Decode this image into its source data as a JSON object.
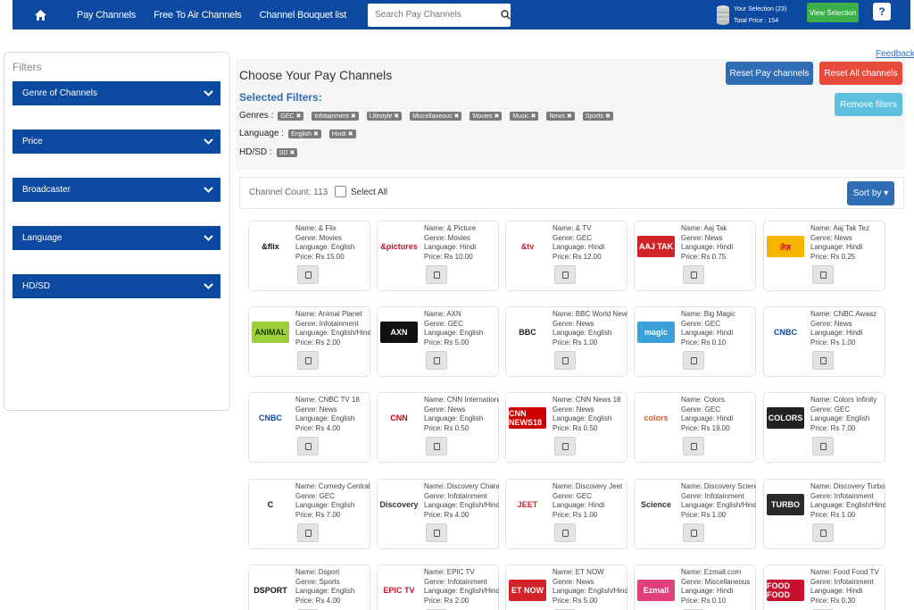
{
  "nav": {
    "links": [
      "Pay Channels",
      "Free To Air Channels",
      "Channel Bouquet list"
    ],
    "search_placeholder": "Search Pay Channels",
    "selection_label": "Your Selection (23)",
    "total_price": "Total Price : 154",
    "view_selection": "View Selection",
    "help": "?"
  },
  "sidebar": {
    "title": "Filters",
    "items": [
      "Genre of Channels",
      "Price",
      "Broadcaster",
      "Language",
      "HD/SD"
    ]
  },
  "main": {
    "feedback": "Feedback",
    "title": "Choose Your Pay Channels",
    "reset_pay": "Reset Pay channels",
    "reset_all": "Reset All channels",
    "remove_filters": "Remove filters",
    "selected_filters_title": "Selected Filters:",
    "filter_rows": [
      {
        "label": "Genres :",
        "tags": [
          "GEC ✖",
          "Infotainment ✖",
          "Lifestyle ✖",
          "Miscellaneous ✖",
          "Movies ✖",
          "Music ✖",
          "News ✖",
          "Sports ✖"
        ]
      },
      {
        "label": "Language :",
        "tags": [
          "English ✖",
          "Hindi ✖"
        ]
      },
      {
        "label": "HD/SD :",
        "tags": [
          "SD ✖"
        ]
      }
    ],
    "channel_count": "Channel Count: 113",
    "select_all": "Select All",
    "sort_by": "Sort by ▾"
  },
  "channels": [
    {
      "name": "Name: & Flix",
      "genre": "Genre: Movies",
      "language": "Language: English",
      "price": "Price: Rs 15.00",
      "logo": "&flix",
      "logo_color": "#111111",
      "logo_bg": "#ffffff"
    },
    {
      "name": "Name: & Picture",
      "genre": "Genre: Movies",
      "language": "Language: Hindi",
      "price": "Price: Rs 10.00",
      "logo": "&pictures",
      "logo_color": "#c8102e",
      "logo_bg": "#ffffff"
    },
    {
      "name": "Name: & TV",
      "genre": "Genre: GEC",
      "language": "Language: Hindi",
      "price": "Price: Rs 12.00",
      "logo": "&tv",
      "logo_color": "#d6202e",
      "logo_bg": "#ffffff"
    },
    {
      "name": "Name: Aaj Tak",
      "genre": "Genre: News",
      "language": "Language: Hindi",
      "price": "Price: Rs 0.75",
      "logo": "AAJ TAK",
      "logo_color": "#ffffff",
      "logo_bg": "#d2232a"
    },
    {
      "name": "Name: Aaj Tak Tez",
      "genre": "Genre: News",
      "language": "Language: Hindi",
      "price": "Price: Rs 0.25",
      "logo": "तेज़",
      "logo_color": "#c8102e",
      "logo_bg": "#f7b500"
    },
    {
      "name": "Name: Animal Planet",
      "genre": "Genre: Infotainment",
      "language": "Language: English/Hindi",
      "price": "Price: Rs 2.00",
      "logo": "ANIMAL",
      "logo_color": "#1e3d0e",
      "logo_bg": "#9ccf3a"
    },
    {
      "name": "Name: AXN",
      "genre": "Genre: GEC",
      "language": "Language: English",
      "price": "Price: Rs 5.00",
      "logo": "AXN",
      "logo_color": "#ffffff",
      "logo_bg": "#111111"
    },
    {
      "name": "Name: BBC World News",
      "genre": "Genre: News",
      "language": "Language: English",
      "price": "Price: Rs 1.00",
      "logo": "BBC",
      "logo_color": "#222222",
      "logo_bg": "#ffffff"
    },
    {
      "name": "Name: Big Magic",
      "genre": "Genre: GEC",
      "language": "Language: Hindi",
      "price": "Price: Rs 0.10",
      "logo": "magic",
      "logo_color": "#ffffff",
      "logo_bg": "#3aa0d8"
    },
    {
      "name": "Name: CNBC Awaaz",
      "genre": "Genre: News",
      "language": "Language: Hindi",
      "price": "Price: Rs 1.00",
      "logo": "CNBC",
      "logo_color": "#0b4aa0",
      "logo_bg": "#ffffff"
    },
    {
      "name": "Name: CNBC TV 18",
      "genre": "Genre: News",
      "language": "Language: English",
      "price": "Price: Rs 4.00",
      "logo": "CNBC",
      "logo_color": "#0b4aa0",
      "logo_bg": "#ffffff"
    },
    {
      "name": "Name: CNN International",
      "genre": "Genre: News",
      "language": "Language: English",
      "price": "Price: Rs 0.50",
      "logo": "CNN",
      "logo_color": "#cc0000",
      "logo_bg": "#ffffff"
    },
    {
      "name": "Name: CNN News 18",
      "genre": "Genre: News",
      "language": "Language: English",
      "price": "Price: Rs 0.50",
      "logo": "CNN NEWS18",
      "logo_color": "#ffffff",
      "logo_bg": "#cc0000"
    },
    {
      "name": "Name: Colors",
      "genre": "Genre: GEC",
      "language": "Language: Hindi",
      "price": "Price: Rs 19.00",
      "logo": "colors",
      "logo_color": "#e05a2b",
      "logo_bg": "#ffffff"
    },
    {
      "name": "Name: Colors Infinity",
      "genre": "Genre: GEC",
      "language": "Language: English",
      "price": "Price: Rs 7.00",
      "logo": "COLORS",
      "logo_color": "#ffffff",
      "logo_bg": "#222222"
    },
    {
      "name": "Name: Comedy Central",
      "genre": "Genre: GEC",
      "language": "Language: English",
      "price": "Price: Rs 7.00",
      "logo": "C",
      "logo_color": "#111111",
      "logo_bg": "#ffffff"
    },
    {
      "name": "Name: Discovery Channel",
      "genre": "Genre: Infotainment",
      "language": "Language: English/Hindi",
      "price": "Price: Rs 4.00",
      "logo": "Discovery",
      "logo_color": "#333333",
      "logo_bg": "#ffffff"
    },
    {
      "name": "Name: Discovery Jeet",
      "genre": "Genre: GEC",
      "language": "Language: Hindi",
      "price": "Price: Rs 1.00",
      "logo": "JEET",
      "logo_color": "#d6202e",
      "logo_bg": "#ffffff"
    },
    {
      "name": "Name: Discovery Science",
      "genre": "Genre: Infotainment",
      "language": "Language: English/Hindi",
      "price": "Price: Rs 1.00",
      "logo": "Science",
      "logo_color": "#333333",
      "logo_bg": "#ffffff"
    },
    {
      "name": "Name: Discovery Turbo",
      "genre": "Genre: Infotainment",
      "language": "Language: English/Hindi",
      "price": "Price: Rs 1.00",
      "logo": "TURBO",
      "logo_color": "#ffffff",
      "logo_bg": "#2b2b2b"
    },
    {
      "name": "Name: Dsport",
      "genre": "Genre: Sports",
      "language": "Language: English",
      "price": "Price: Rs 4.00",
      "logo": "DSPORT",
      "logo_color": "#111111",
      "logo_bg": "#ffffff"
    },
    {
      "name": "Name: EPIC TV",
      "genre": "Genre: Infotainment",
      "language": "Language: English/Hindi",
      "price": "Price: Rs 2.00",
      "logo": "EPIC TV",
      "logo_color": "#c8102e",
      "logo_bg": "#ffffff"
    },
    {
      "name": "Name: ET NOW",
      "genre": "Genre: News",
      "language": "Language: English/Hindi",
      "price": "Price: Rs 5.00",
      "logo": "ET NOW",
      "logo_color": "#ffffff",
      "logo_bg": "#d2232a"
    },
    {
      "name": "Name: Ezmall.com",
      "genre": "Genre: Miscellaneous",
      "language": "Language: Hindi",
      "price": "Price: Rs 0.10",
      "logo": "Ezmall",
      "logo_color": "#ffffff",
      "logo_bg": "#e2407c"
    },
    {
      "name": "Name: Food Food TV",
      "genre": "Genre: Infotainment",
      "language": "Language: Hindi",
      "price": "Price: Rs 0.30",
      "logo": "FOOD FOOD",
      "logo_color": "#ffffff",
      "logo_bg": "#c8102e"
    }
  ]
}
